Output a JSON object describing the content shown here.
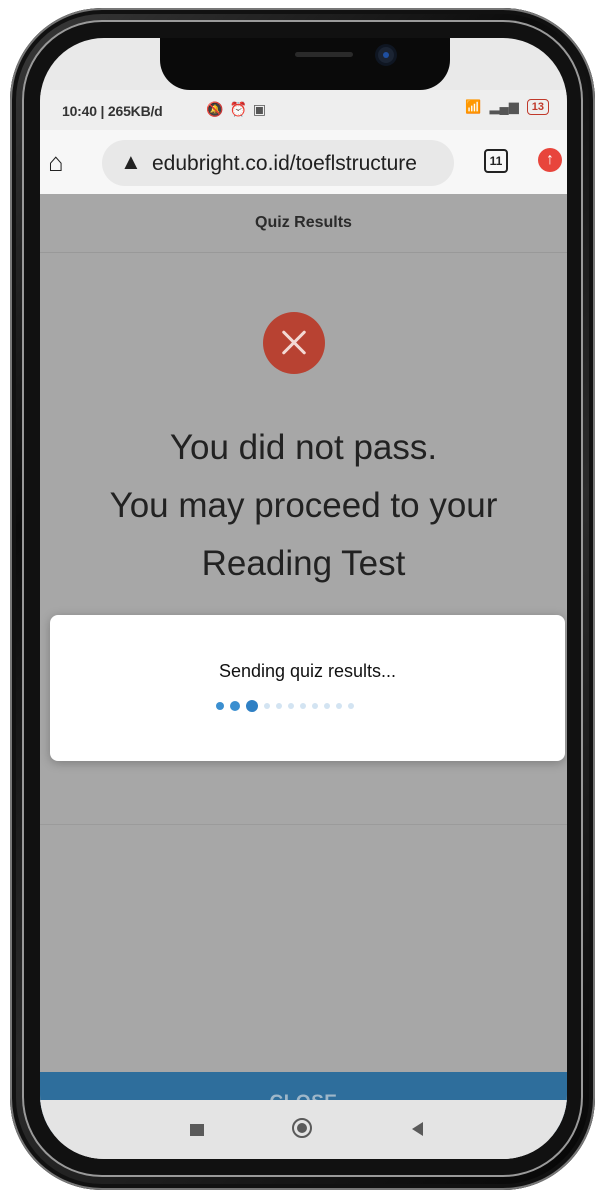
{
  "status_bar": {
    "time_info": "10:40 | 265KB/d",
    "battery": "13"
  },
  "browser": {
    "url": "edubright.co.id/toeflstructure",
    "tab_count": "11"
  },
  "page": {
    "title": "Quiz Results",
    "result_lines": [
      "You did not pass.",
      "You may proceed to your",
      "Reading Test"
    ],
    "modal_text": "Sending quiz results...",
    "close_label": "CLOSE"
  },
  "colors": {
    "overlay_bg": "#a7a7a7",
    "fail_icon": "#b84232",
    "close_button": "#2e6e9c",
    "loader_active": "#3b8fd0"
  },
  "icons": {
    "home": "home-icon",
    "warning": "warning-icon",
    "tabs": "tabs-icon",
    "update": "update-icon",
    "fail": "close-x-icon"
  }
}
